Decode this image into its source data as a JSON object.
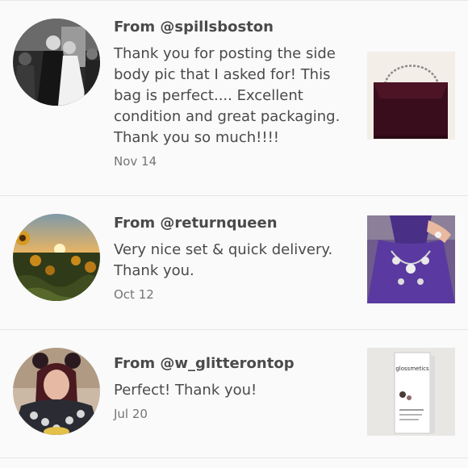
{
  "reviews": [
    {
      "author": "From @spillsboston",
      "text": "Thank you for posting the side body pic that I asked for! This bag is perfect.... Excellent condition and great packaging. Thank you so much!!!!",
      "date": "Nov 14",
      "avatar_icon": "wedding-photo-avatar",
      "product_icon": "velvet-chain-bag-thumbnail"
    },
    {
      "author": "From @returnqueen",
      "text": "Very nice set & quick delivery. Thank you.",
      "date": "Oct 12",
      "avatar_icon": "sunflower-field-avatar",
      "product_icon": "necklace-on-bust-thumbnail"
    },
    {
      "author": "From @w_glitterontop",
      "text": "Perfect! Thank you!",
      "date": "Jul 20",
      "avatar_icon": "woman-with-mouse-ears-avatar",
      "product_icon": "glossmetics-box-thumbnail"
    }
  ],
  "product_box_label": "glossmetics"
}
